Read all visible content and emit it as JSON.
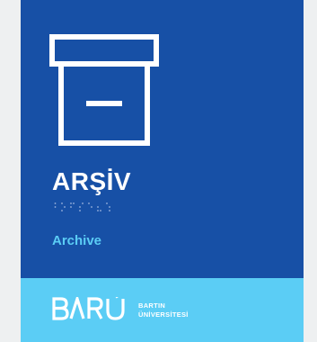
{
  "sign": {
    "title": "ARŞİV",
    "subtitle": "Archive",
    "icon": "archive-box-icon",
    "braille": "braille-archive"
  },
  "footer": {
    "logo_text": "BARÜ",
    "university_line1": "BARTIN",
    "university_line2": "ÜNİVERSİTESİ"
  },
  "colors": {
    "panel": "#1750a6",
    "accent": "#5bcdf5",
    "text": "#ffffff",
    "background": "#eef0f1"
  }
}
